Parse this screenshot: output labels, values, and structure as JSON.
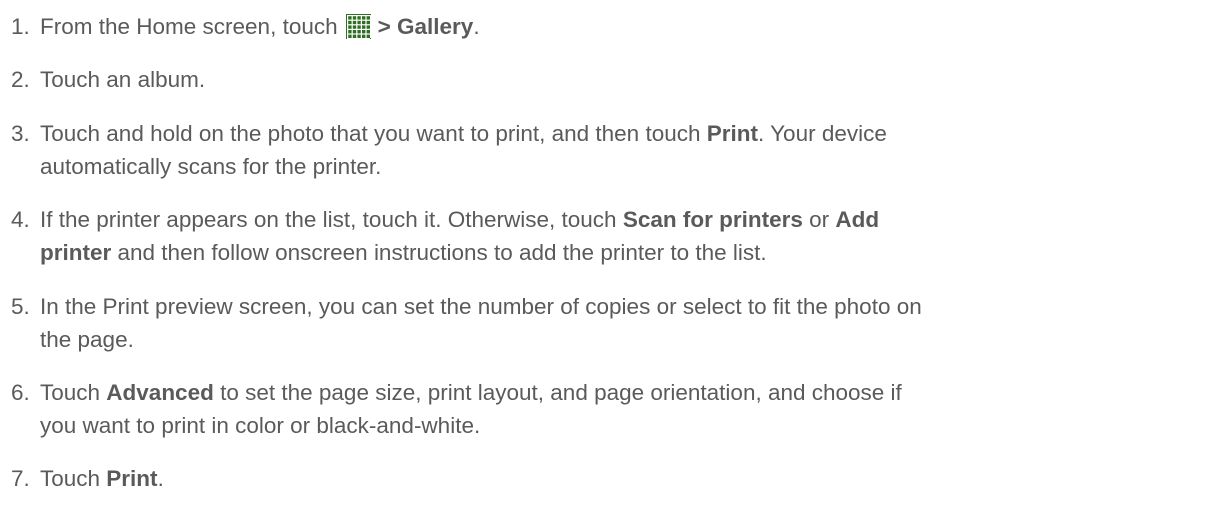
{
  "steps": [
    {
      "number": "1.",
      "lines": [
        {
          "segments": [
            {
              "text": "From the Home screen, touch",
              "bold": false
            },
            {
              "icon": "apps-grid-icon"
            },
            {
              "text": "> Gallery",
              "bold": true
            },
            {
              "text": ".",
              "bold": false
            }
          ]
        }
      ]
    },
    {
      "number": "2.",
      "lines": [
        {
          "segments": [
            {
              "text": "Touch an album.",
              "bold": false
            }
          ]
        }
      ]
    },
    {
      "number": "3.",
      "lines": [
        {
          "segments": [
            {
              "text": "Touch and hold on the photo that you want to print, and then touch ",
              "bold": false
            },
            {
              "text": "Print",
              "bold": true
            },
            {
              "text": ". Your device",
              "bold": false
            }
          ]
        },
        {
          "segments": [
            {
              "text": "automatically scans for the printer.",
              "bold": false
            }
          ]
        }
      ]
    },
    {
      "number": "4.",
      "lines": [
        {
          "segments": [
            {
              "text": "If the printer appears on the list, touch it. Otherwise, touch ",
              "bold": false
            },
            {
              "text": "Scan for printers",
              "bold": true
            },
            {
              "text": " or ",
              "bold": false
            },
            {
              "text": "Add",
              "bold": true
            }
          ]
        },
        {
          "segments": [
            {
              "text": "printer",
              "bold": true
            },
            {
              "text": " and then follow onscreen instructions to add the printer to the list.",
              "bold": false
            }
          ]
        }
      ]
    },
    {
      "number": "5.",
      "lines": [
        {
          "segments": [
            {
              "text": "In the Print preview screen, you can set the number of copies or select to fit the photo on",
              "bold": false
            }
          ]
        },
        {
          "segments": [
            {
              "text": "the page.",
              "bold": false
            }
          ]
        }
      ]
    },
    {
      "number": "6.",
      "lines": [
        {
          "segments": [
            {
              "text": "Touch ",
              "bold": false
            },
            {
              "text": "Advanced",
              "bold": true
            },
            {
              "text": " to set the page size, print layout, and page orientation, and choose if",
              "bold": false
            }
          ]
        },
        {
          "segments": [
            {
              "text": "you want to print in color or black-and-white.",
              "bold": false
            }
          ]
        }
      ]
    },
    {
      "number": "7.",
      "lines": [
        {
          "segments": [
            {
              "text": "Touch ",
              "bold": false
            },
            {
              "text": "Print",
              "bold": true
            },
            {
              "text": ".",
              "bold": false
            }
          ]
        }
      ]
    }
  ],
  "colors": {
    "text": "#5a5a5a",
    "icon_fill": "#2f6f24",
    "icon_grid": "#ffffff"
  }
}
